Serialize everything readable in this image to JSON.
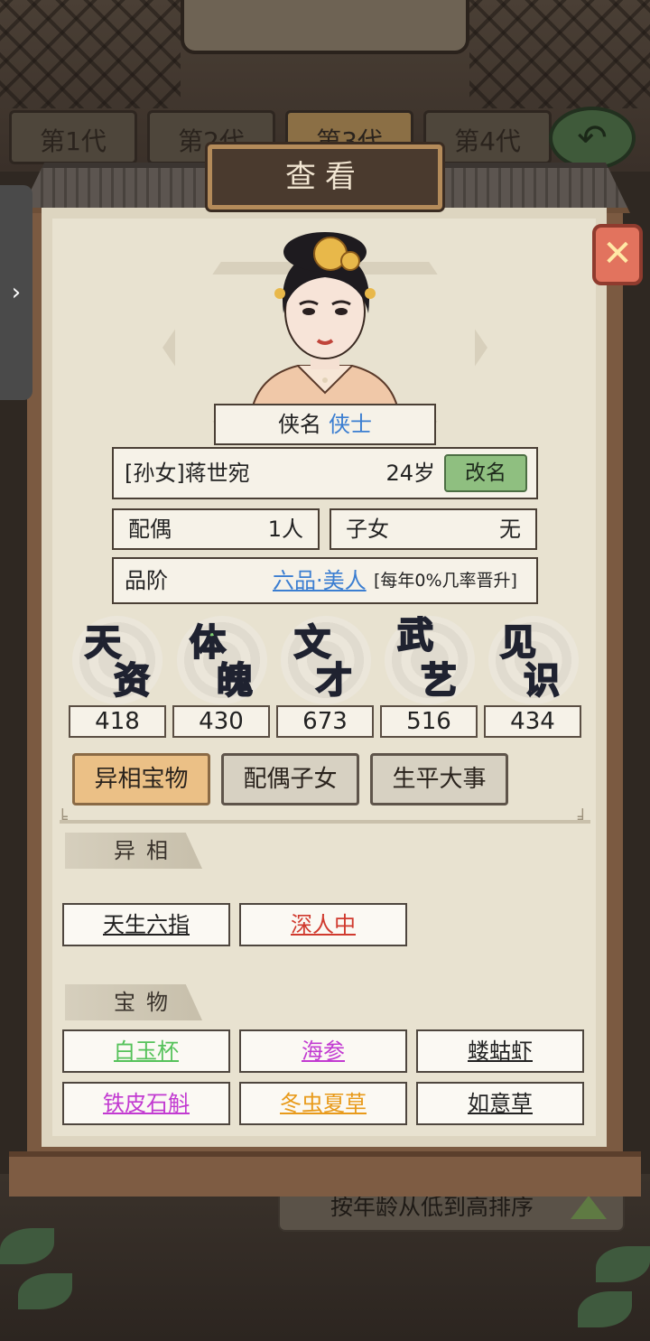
{
  "background": {
    "generation_tabs": [
      "第1代",
      "第2代",
      "第3代",
      "第4代"
    ],
    "sort_label": "按年龄从低到高排序"
  },
  "dialog": {
    "title": "查看",
    "hero_label": "侠名",
    "hero_value": "侠士",
    "name": "[孙女]蒋世宛",
    "age": "24岁",
    "rename_label": "改名",
    "spouse_label": "配偶",
    "spouse_value": "1人",
    "children_label": "子女",
    "children_value": "无",
    "rank_label": "品阶",
    "rank_value": "六品·美人",
    "rank_note": "[每年0%几率晋升]"
  },
  "attributes": [
    {
      "chars": [
        "天",
        "资"
      ],
      "value": "418",
      "color": "#6f9be6"
    },
    {
      "chars": [
        "体",
        "魄"
      ],
      "value": "430",
      "color": "#7fcf72"
    },
    {
      "chars": [
        "文",
        "才"
      ],
      "value": "673",
      "color": "#c174de"
    },
    {
      "chars": [
        "武",
        "艺"
      ],
      "value": "516",
      "color": "#e8b24a"
    },
    {
      "chars": [
        "见",
        "识"
      ],
      "value": "434",
      "color": "#e26a66"
    }
  ],
  "tabs": [
    {
      "label": "异相宝物",
      "active": true
    },
    {
      "label": "配偶子女",
      "active": false
    },
    {
      "label": "生平大事",
      "active": false
    }
  ],
  "traits": {
    "title": "异相",
    "items": [
      {
        "label": "天生六指",
        "color": "#222222"
      },
      {
        "label": "深人中",
        "color": "#d03a2e"
      }
    ]
  },
  "treasures": {
    "title": "宝物",
    "items": [
      {
        "label": "白玉杯",
        "color": "#55c25a"
      },
      {
        "label": "海参",
        "color": "#c23ad1"
      },
      {
        "label": "蝼蛄虾",
        "color": "#222222"
      },
      {
        "label": "铁皮石斛",
        "color": "#c23ad1"
      },
      {
        "label": "冬虫夏草",
        "color": "#e89a1a"
      },
      {
        "label": "如意草",
        "color": "#222222"
      }
    ]
  },
  "icons": {
    "close": "close-icon",
    "back": "back-arrow-icon",
    "side": "chevron-right-icon",
    "sort": "sort-triangle-icon"
  }
}
